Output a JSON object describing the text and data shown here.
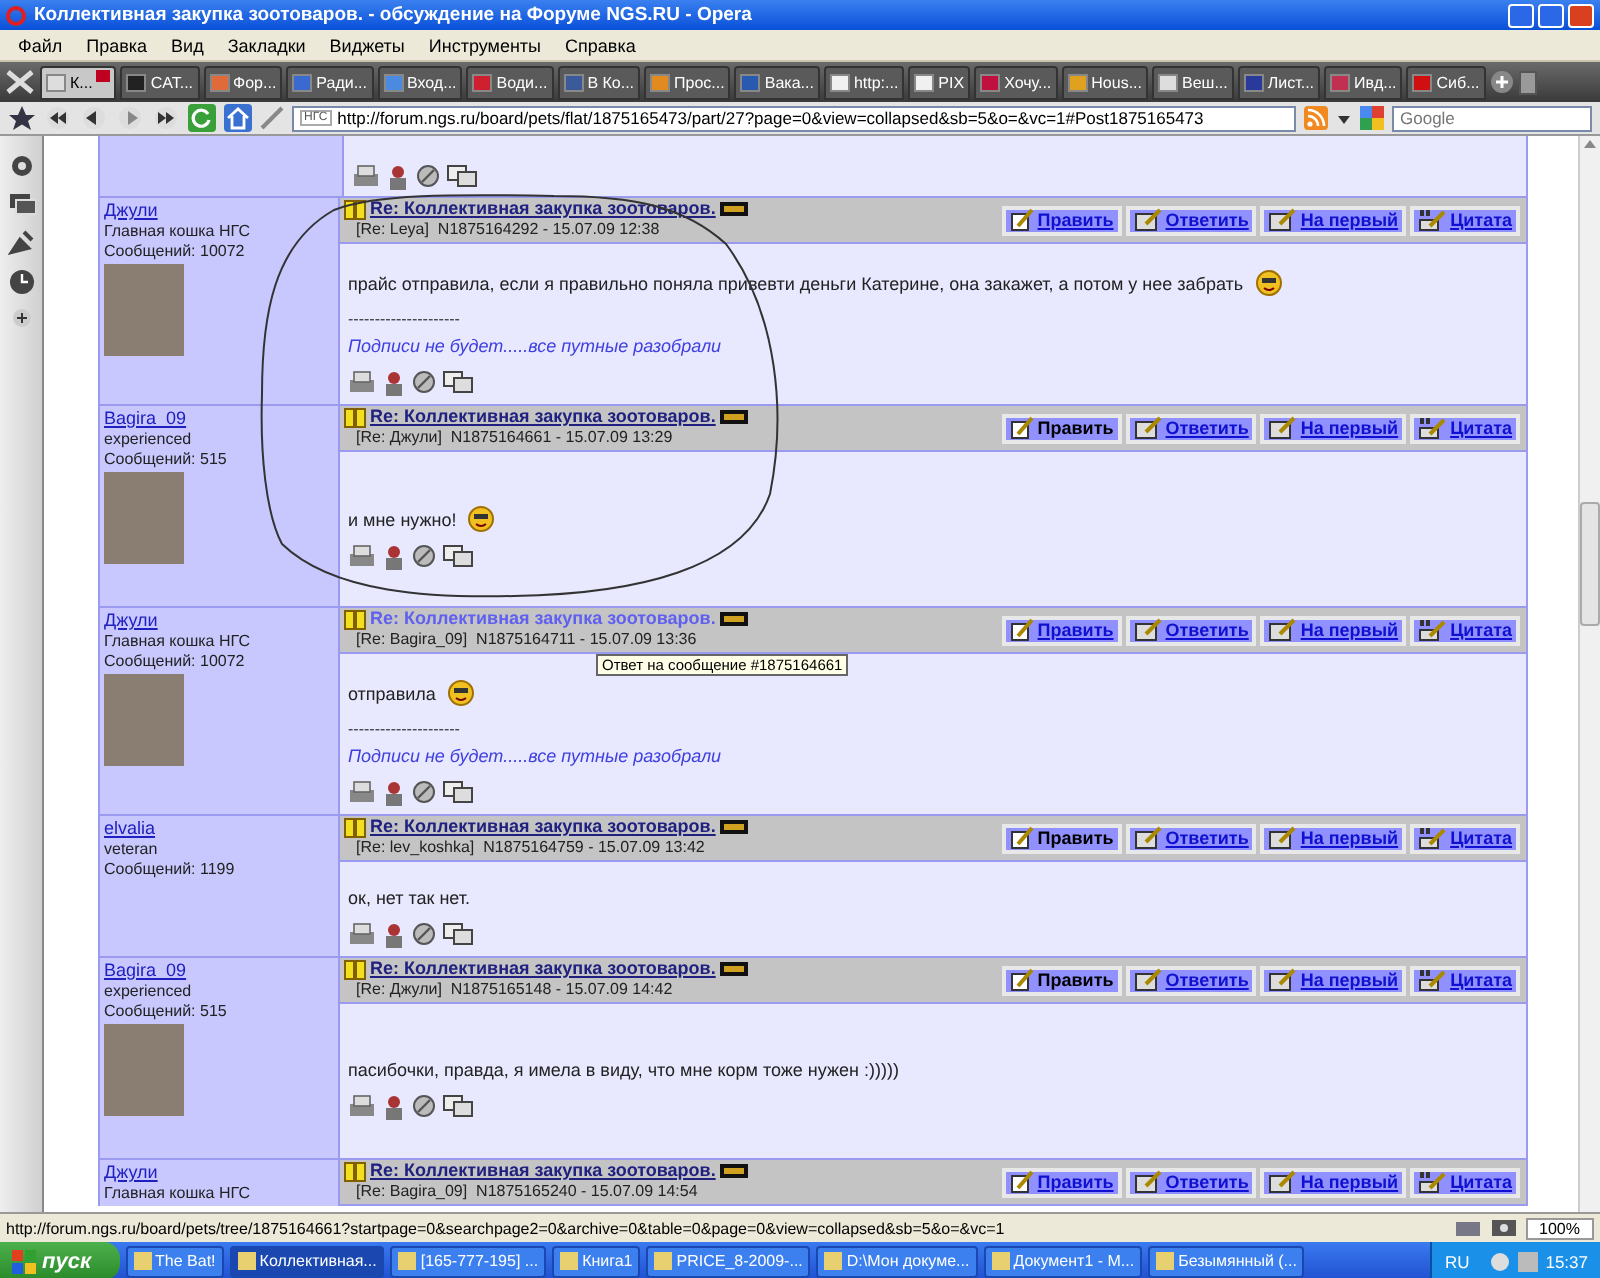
{
  "window": {
    "title": "Коллективная закупка зоотоваров. - обсуждение на Форуме NGS.RU - Opera"
  },
  "menu": [
    "Файл",
    "Правка",
    "Вид",
    "Закладки",
    "Виджеты",
    "Инструменты",
    "Справка"
  ],
  "tabs": [
    {
      "label": "К...",
      "selected": true,
      "color": "#dddddd"
    },
    {
      "label": "CAT...",
      "selected": false,
      "color": "#222222"
    },
    {
      "label": "Фор...",
      "selected": false,
      "color": "#e06a3a"
    },
    {
      "label": "Ради...",
      "selected": false,
      "color": "#3a6ad0"
    },
    {
      "label": "Вход...",
      "selected": false,
      "color": "#4a8ae0"
    },
    {
      "label": "Води...",
      "selected": false,
      "color": "#d02030"
    },
    {
      "label": "В Ко...",
      "selected": false,
      "color": "#3a5a9a"
    },
    {
      "label": "Прос...",
      "selected": false,
      "color": "#e08a20"
    },
    {
      "label": "Вака...",
      "selected": false,
      "color": "#2a5ab0"
    },
    {
      "label": "http:...",
      "selected": false,
      "color": "#f0f0f0"
    },
    {
      "label": "PIX",
      "selected": false,
      "color": "#f0f0f0"
    },
    {
      "label": "Хочу...",
      "selected": false,
      "color": "#c01040"
    },
    {
      "label": "Hous...",
      "selected": false,
      "color": "#e0a020"
    },
    {
      "label": "Веш...",
      "selected": false,
      "color": "#dddddd"
    },
    {
      "label": "Лист...",
      "selected": false,
      "color": "#2a3a9a"
    },
    {
      "label": "Ивд...",
      "selected": false,
      "color": "#c03050"
    },
    {
      "label": "Сиб...",
      "selected": false,
      "color": "#d01010"
    }
  ],
  "address": {
    "site_label": "НГС",
    "url": "http://forum.ngs.ru/board/pets/flat/1875165473/part/27?page=0&view=collapsed&sb=5&o=&vc=1#Post1875165473"
  },
  "search": {
    "placeholder": "Google"
  },
  "forum": {
    "posts": [
      {
        "author": "Джули",
        "rank": "Главная кошка НГС",
        "count": "Сообщений: 10072",
        "avatar": true,
        "title": "Re: Коллективная закупка зоотоваров.",
        "hovered": false,
        "meta": "[Re: Leya]  N1875164292 - 15.07.09 12:38",
        "text": "прайс отправила, если я правильно поняла привевти деньги Катерине, она закажет, а потом у нее забрать",
        "smiley": true,
        "signature_rule": "---------------------",
        "signature": "Подписи не будет.....все путные разобрали",
        "actions": [
          {
            "kind": "edit",
            "label": "Править",
            "link": true
          },
          {
            "kind": "reply",
            "label": "Ответить",
            "link": true
          },
          {
            "kind": "top",
            "label": "На первый",
            "link": true
          },
          {
            "kind": "quote",
            "label": "Цитата",
            "link": true
          }
        ]
      },
      {
        "author": "Bagira_09",
        "rank": "experienced",
        "count": "Сообщений: 515",
        "avatar": true,
        "title": "Re: Коллективная закупка зоотоваров.",
        "hovered": false,
        "meta": "[Re: Джули]  N1875164661 - 15.07.09 13:29",
        "text": "и мне нужно!",
        "smiley": true,
        "actions": [
          {
            "kind": "edit",
            "label": "Править",
            "link": false
          },
          {
            "kind": "reply",
            "label": "Ответить",
            "link": true
          },
          {
            "kind": "top",
            "label": "На первый",
            "link": true
          },
          {
            "kind": "quote",
            "label": "Цитата",
            "link": true
          }
        ]
      },
      {
        "author": "Джули",
        "rank": "Главная кошка НГС",
        "count": "Сообщений: 10072",
        "avatar": true,
        "title": "Re: Коллективная закупка зоотоваров.",
        "hovered": true,
        "meta": "[Re: Bagira_09]  N1875164711 - 15.07.09 13:36",
        "tooltip": "Ответ на сообщение #1875164661",
        "text": "отправила",
        "smiley": true,
        "signature_rule": "---------------------",
        "signature": "Подписи не будет.....все путные разобрали",
        "actions": [
          {
            "kind": "edit",
            "label": "Править",
            "link": true
          },
          {
            "kind": "reply",
            "label": "Ответить",
            "link": true
          },
          {
            "kind": "top",
            "label": "На первый",
            "link": true
          },
          {
            "kind": "quote",
            "label": "Цитата",
            "link": true
          }
        ]
      },
      {
        "author": "elvalia",
        "rank": "veteran",
        "count": "Сообщений: 1199",
        "avatar": false,
        "title": "Re: Коллективная закупка зоотоваров.",
        "hovered": false,
        "meta": "[Re: lev_koshka]  N1875164759 - 15.07.09 13:42",
        "text": "ок, нет так нет.",
        "smiley": false,
        "actions": [
          {
            "kind": "edit",
            "label": "Править",
            "link": false
          },
          {
            "kind": "reply",
            "label": "Ответить",
            "link": true
          },
          {
            "kind": "top",
            "label": "На первый",
            "link": true
          },
          {
            "kind": "quote",
            "label": "Цитата",
            "link": true
          }
        ]
      },
      {
        "author": "Bagira_09",
        "rank": "experienced",
        "count": "Сообщений: 515",
        "avatar": true,
        "title": "Re: Коллективная закупка зоотоваров.",
        "hovered": false,
        "meta": "[Re: Джули]  N1875165148 - 15.07.09 14:42",
        "text": "пасибочки, правда, я имела в виду, что мне корм тоже нужен :)))))",
        "smiley": false,
        "actions": [
          {
            "kind": "edit",
            "label": "Править",
            "link": false
          },
          {
            "kind": "reply",
            "label": "Ответить",
            "link": true
          },
          {
            "kind": "top",
            "label": "На первый",
            "link": true
          },
          {
            "kind": "quote",
            "label": "Цитата",
            "link": true
          }
        ]
      },
      {
        "author": "Джули",
        "rank": "Главная кошка НГС",
        "avatar": false,
        "title": "Re: Коллективная закупка зоотоваров.",
        "hovered": false,
        "meta": "[Re: Bagira_09]  N1875165240 - 15.07.09 14:54",
        "actions": [
          {
            "kind": "edit",
            "label": "Править",
            "link": true
          },
          {
            "kind": "reply",
            "label": "Ответить",
            "link": true
          },
          {
            "kind": "top",
            "label": "На первый",
            "link": true
          },
          {
            "kind": "quote",
            "label": "Цитата",
            "link": true
          }
        ]
      }
    ]
  },
  "status_bar": {
    "url": "http://forum.ngs.ru/board/pets/tree/1875164661?startpage=0&searchpage2=0&archive=0&table=0&page=0&view=collapsed&sb=5&o=&vc=1",
    "zoom": "100%"
  },
  "taskbar": {
    "start": "пуск",
    "tasks": [
      {
        "label": "The Bat!",
        "selected": false
      },
      {
        "label": "Коллективная...",
        "selected": true
      },
      {
        "label": "[165-777-195] ...",
        "selected": false
      },
      {
        "label": "Книга1",
        "selected": false
      },
      {
        "label": "PRICE_8-2009-...",
        "selected": false
      },
      {
        "label": "D:\\Мон докуме...",
        "selected": false
      },
      {
        "label": "Документ1 - M...",
        "selected": false
      },
      {
        "label": "Безымянный (...",
        "selected": false
      }
    ],
    "language": "RU",
    "clock": "15:37"
  }
}
